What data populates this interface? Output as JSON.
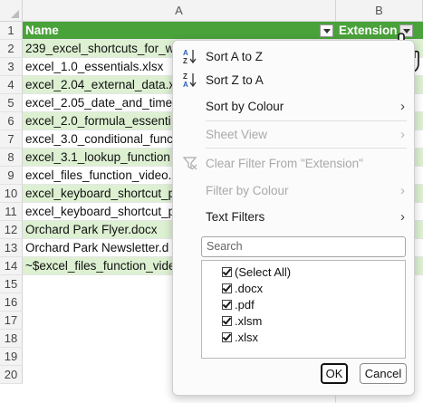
{
  "columns": {
    "a": "A",
    "b": "B"
  },
  "rows": [
    "1",
    "2",
    "3",
    "4",
    "5",
    "6",
    "7",
    "8",
    "9",
    "10",
    "11",
    "12",
    "13",
    "14",
    "15",
    "16",
    "17",
    "18",
    "19",
    "20"
  ],
  "header": {
    "name": "Name",
    "extension": "Extension"
  },
  "files": [
    "239_excel_shortcuts_for_w",
    "excel_1.0_essentials.xlsx",
    "excel_2.04_external_data.x",
    "excel_2.05_date_and_time.",
    "excel_2.0_formula_essenti",
    "excel_3.0_conditional_func",
    "excel_3.1_lookup_function",
    "excel_files_function_video.",
    "excel_keyboard_shortcut_p",
    "excel_keyboard_shortcut_p",
    "Orchard Park Flyer.docx",
    "Orchard Park Newsletter.d",
    "~$excel_files_function_vide"
  ],
  "menu": {
    "sort_az": "Sort A to Z",
    "sort_za": "Sort Z to A",
    "sort_by_colour": "Sort by Colour",
    "sheet_view": "Sheet View",
    "clear_filter": "Clear Filter From \"Extension\"",
    "filter_by_colour": "Filter by Colour",
    "text_filters": "Text Filters",
    "search_placeholder": "Search",
    "list": [
      "(Select All)",
      ".docx",
      ".pdf",
      ".xlsm",
      ".xlsx"
    ],
    "ok": "OK",
    "cancel": "Cancel"
  },
  "colors": {
    "header_green": "#4aa23a",
    "band_green": "#ddf0d2"
  }
}
